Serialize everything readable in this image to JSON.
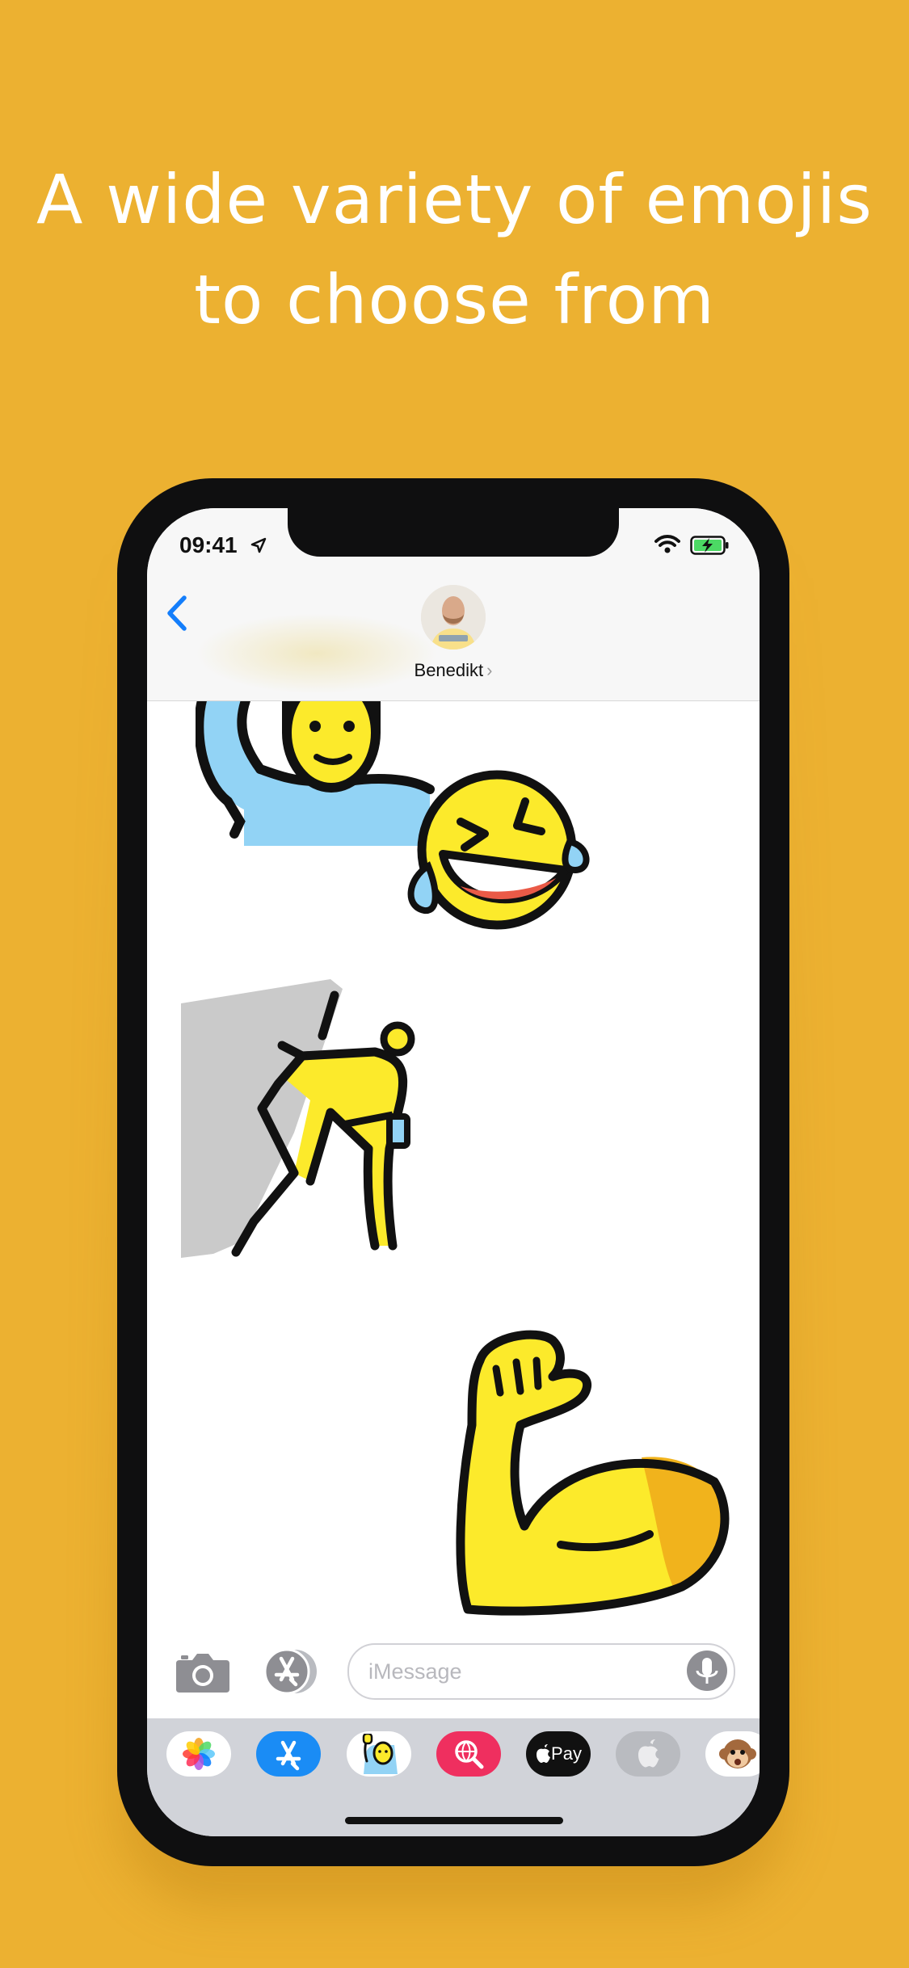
{
  "headline": {
    "line1": "A wide variety of emojis",
    "line2": "to choose from"
  },
  "status_bar": {
    "time": "09:41",
    "icons": [
      "location-arrow-icon",
      "wifi-icon",
      "battery-charging-icon"
    ]
  },
  "conversation": {
    "contact_name": "Benedikt",
    "back_icon": "chevron-left-icon"
  },
  "stickers": [
    "person-raising-hand",
    "rolling-on-the-floor-laughing",
    "person-climbing",
    "flexed-biceps"
  ],
  "composer": {
    "camera_icon": "camera-icon",
    "apps_icon": "app-store-icon",
    "placeholder": "iMessage",
    "mic_icon": "microphone-icon"
  },
  "app_drawer": {
    "apps": [
      {
        "icon": "photos-icon",
        "color": "#ffffff"
      },
      {
        "icon": "app-store-icon",
        "color": "#1a8cf5"
      },
      {
        "icon": "sticker-app-icon",
        "color": "#ffffff"
      },
      {
        "icon": "search-globe-icon",
        "color": "#ef2f5f"
      },
      {
        "icon": "apple-pay-icon",
        "label": "Pay",
        "color": "#111111"
      },
      {
        "icon": "apple-music-icon",
        "color": "#b9bbc0"
      },
      {
        "icon": "animoji-monkey-icon",
        "color": "#ffffff"
      }
    ]
  },
  "colors": {
    "background": "#ECB131",
    "accent_blue": "#147EFB",
    "emoji_yellow": "#FCEA2B"
  }
}
